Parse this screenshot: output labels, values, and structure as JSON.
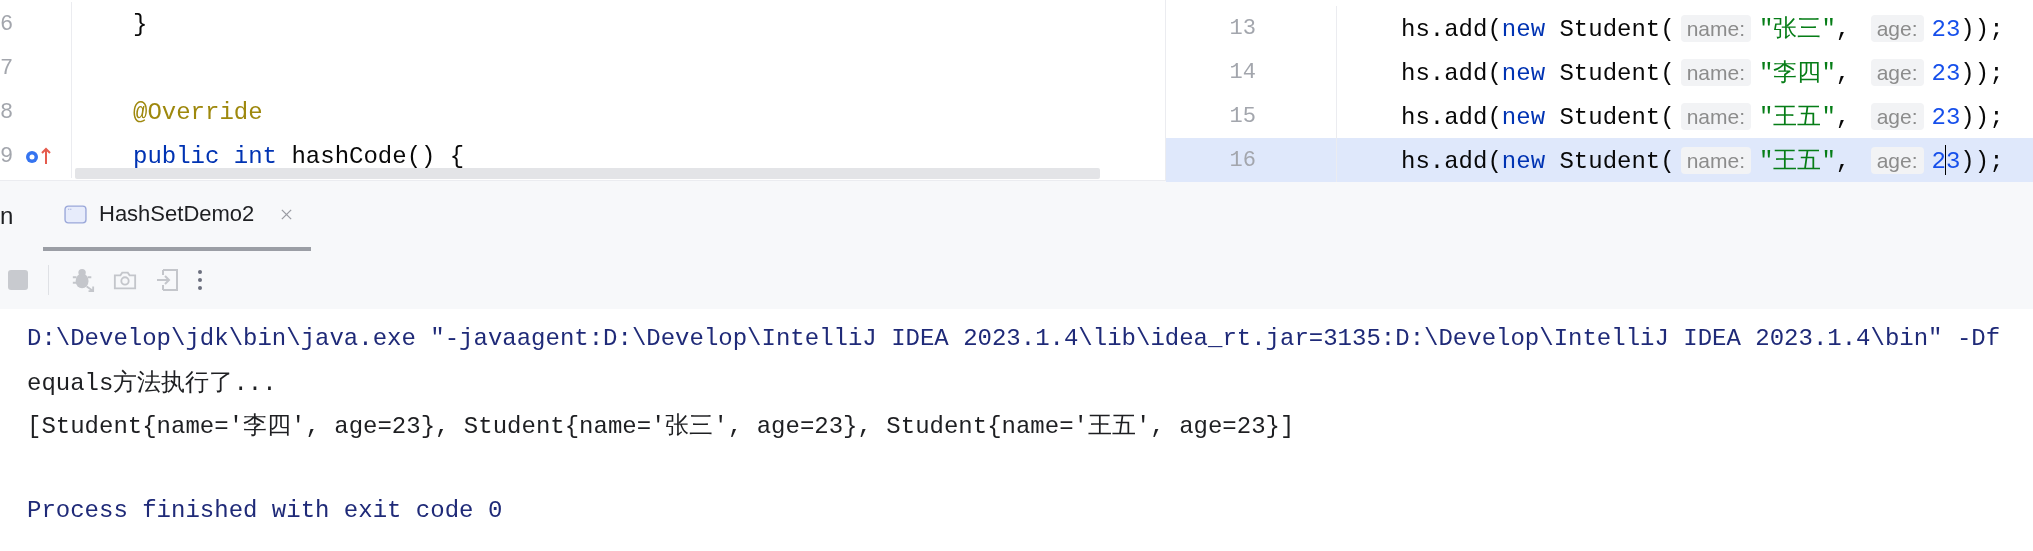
{
  "left_editor": {
    "lines": [
      {
        "number": "6",
        "tokens": [
          {
            "kind": "plain",
            "text": "}"
          }
        ]
      },
      {
        "number": "7"
      },
      {
        "number": "8",
        "tokens": [
          {
            "kind": "annotation",
            "text": "@Override"
          }
        ]
      },
      {
        "number": "9",
        "override_marker": true,
        "tokens": [
          {
            "kind": "keyword",
            "text": "public int"
          },
          {
            "kind": "plain",
            "text": " hashCode() {"
          }
        ]
      }
    ]
  },
  "right_editor": {
    "lines": [
      {
        "number": "13",
        "current": false,
        "tokens": [
          {
            "kind": "plain",
            "text": "hs.add("
          },
          {
            "kind": "keyword",
            "text": "new"
          },
          {
            "kind": "plain",
            "text": " Student("
          },
          {
            "kind": "hint",
            "text": "name:"
          },
          {
            "kind": "string",
            "text": "\"张三\""
          },
          {
            "kind": "plain",
            "text": ", "
          },
          {
            "kind": "hint",
            "text": "age:"
          },
          {
            "kind": "number",
            "text": "23"
          },
          {
            "kind": "plain",
            "text": "));"
          }
        ]
      },
      {
        "number": "14",
        "current": false,
        "tokens": [
          {
            "kind": "plain",
            "text": "hs.add("
          },
          {
            "kind": "keyword",
            "text": "new"
          },
          {
            "kind": "plain",
            "text": " Student("
          },
          {
            "kind": "hint",
            "text": "name:"
          },
          {
            "kind": "string",
            "text": "\"李四\""
          },
          {
            "kind": "plain",
            "text": ", "
          },
          {
            "kind": "hint",
            "text": "age:"
          },
          {
            "kind": "number",
            "text": "23"
          },
          {
            "kind": "plain",
            "text": "));"
          }
        ]
      },
      {
        "number": "15",
        "current": false,
        "tokens": [
          {
            "kind": "plain",
            "text": "hs.add("
          },
          {
            "kind": "keyword",
            "text": "new"
          },
          {
            "kind": "plain",
            "text": " Student("
          },
          {
            "kind": "hint",
            "text": "name:"
          },
          {
            "kind": "string",
            "text": "\"王五\""
          },
          {
            "kind": "plain",
            "text": ", "
          },
          {
            "kind": "hint",
            "text": "age:"
          },
          {
            "kind": "number",
            "text": "23"
          },
          {
            "kind": "plain",
            "text": "));"
          }
        ]
      },
      {
        "number": "16",
        "current": true,
        "tokens": [
          {
            "kind": "plain",
            "text": "hs.add("
          },
          {
            "kind": "keyword",
            "text": "new"
          },
          {
            "kind": "plain",
            "text": " Student("
          },
          {
            "kind": "hint",
            "text": "name:"
          },
          {
            "kind": "string",
            "text": "\"王五\""
          },
          {
            "kind": "plain",
            "text": ", "
          },
          {
            "kind": "hint",
            "text": "age:"
          },
          {
            "kind": "number",
            "text": "23"
          },
          {
            "kind": "plain",
            "text": "));"
          }
        ]
      }
    ]
  },
  "run_panel": {
    "title": "n",
    "tabs": [
      {
        "label": "HashSetDemo2",
        "selected": true
      }
    ],
    "toolbar": [
      {
        "kind": "stop"
      },
      {
        "kind": "separator"
      },
      {
        "kind": "debug"
      },
      {
        "kind": "camera"
      },
      {
        "kind": "exit"
      },
      {
        "kind": "more"
      }
    ],
    "console": [
      {
        "kind": "command",
        "text": "D:\\Develop\\jdk\\bin\\java.exe \"-javaagent:D:\\Develop\\IntelliJ IDEA 2023.1.4\\lib\\idea_rt.jar=3135:D:\\Develop\\IntelliJ IDEA 2023.1.4\\bin\" -Df"
      },
      {
        "kind": "output",
        "text": "equals方法执行了..."
      },
      {
        "kind": "output",
        "text": "[Student{name='李四', age=23}, Student{name='张三', age=23}, Student{name='王五', age=23}]"
      },
      {
        "kind": "blank"
      },
      {
        "kind": "exit",
        "text": "Process finished with exit code 0"
      }
    ]
  }
}
